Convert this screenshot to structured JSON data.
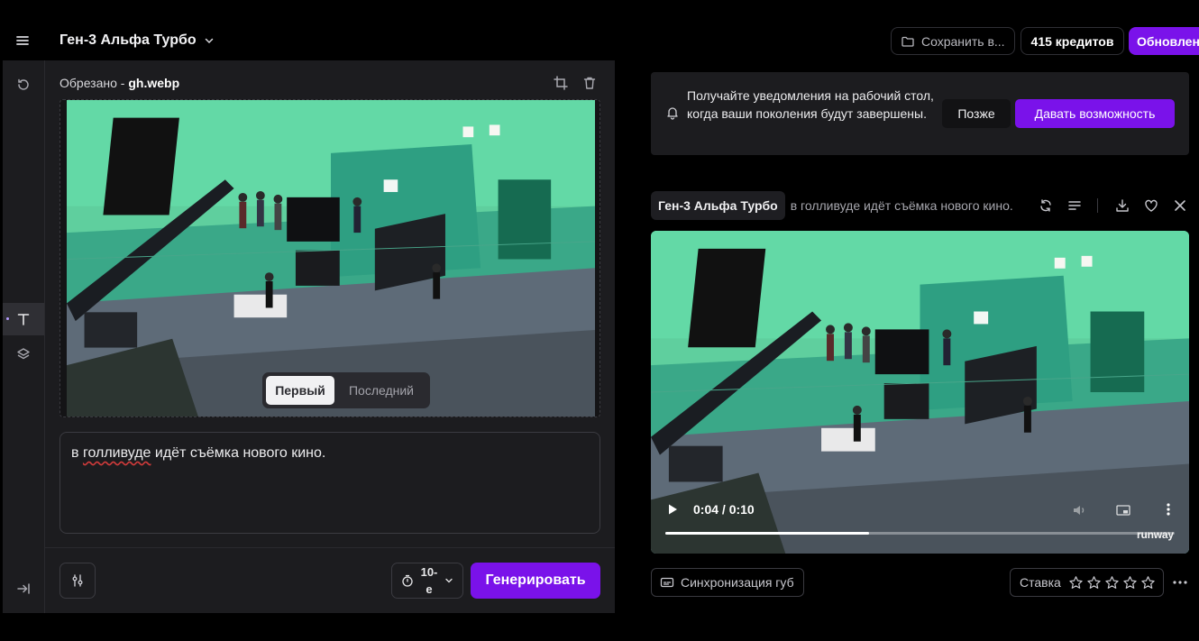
{
  "header": {
    "model_name": "Ген-3 Альфа Турбо",
    "save_label": "Сохранить в...",
    "credits_label": "415 кредитов",
    "upgrade_label": "Обновлен"
  },
  "sidebar": {
    "items": [
      {
        "name": "history",
        "icon": "history-icon"
      },
      {
        "name": "text",
        "icon": "text-icon",
        "active": true
      },
      {
        "name": "layers",
        "icon": "layers-icon"
      },
      {
        "name": "collapse",
        "icon": "collapse-panel-icon"
      }
    ]
  },
  "editor": {
    "crop_prefix": "Обрезано - ",
    "file_name": "gh.webp",
    "frame_toggle": {
      "first": "Первый",
      "last": "Последний",
      "selected": "Первый"
    },
    "prompt_word1": "в ",
    "prompt_misspelled": "голливуде",
    "prompt_rest": " идёт съёмка нового кино.",
    "duration_label": "10-е",
    "generate_label": "Генерировать"
  },
  "notification": {
    "message": "Получайте уведомления на рабочий стол, когда ваши поколения будут завершены.",
    "later_label": "Позже",
    "allow_label": "Давать возможность"
  },
  "generation": {
    "model_name": "Ген-3 Альфа Турбо",
    "prompt": "в голливуде идёт съёмка нового кино.",
    "video": {
      "time": "0:04 / 0:10",
      "progress": 0.4,
      "watermark": "runway"
    },
    "lipsync_label": "Синхронизация губ",
    "rating_label": "Ставка",
    "rating_max": 5
  },
  "colors": {
    "accent": "#7a12ea",
    "panel": "#1c1c1f",
    "background": "#000000"
  }
}
